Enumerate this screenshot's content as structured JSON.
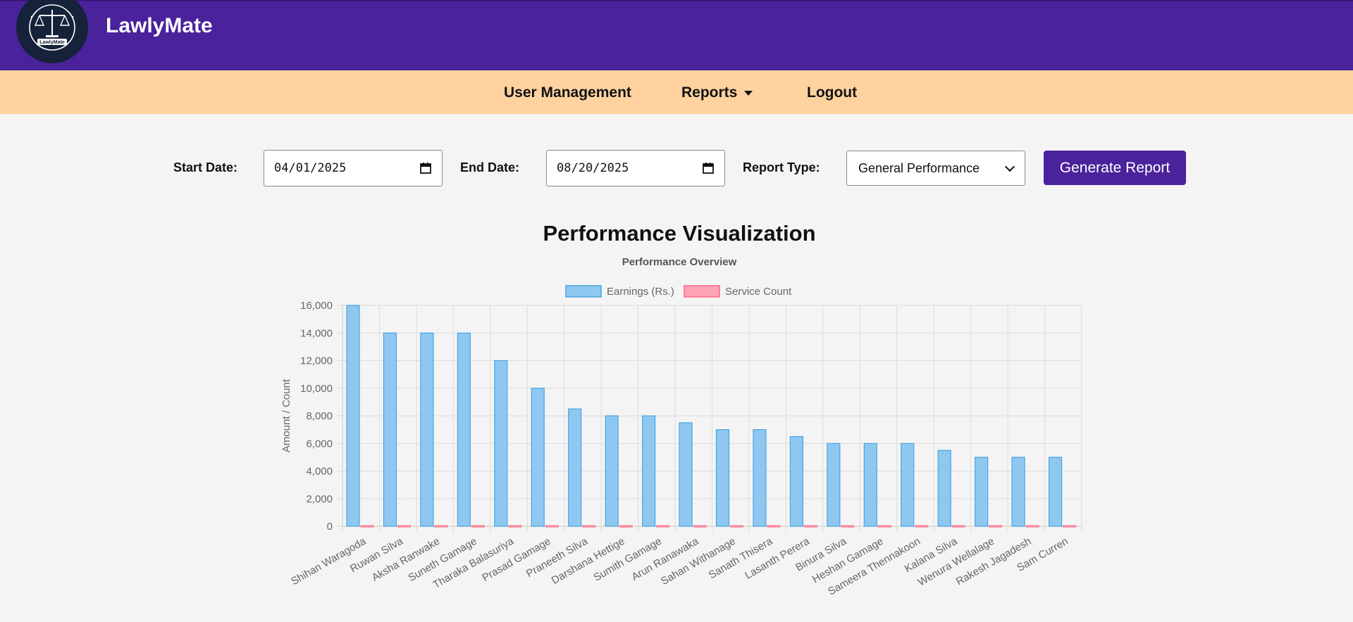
{
  "app": {
    "title": "LawlyMate",
    "logo_text": "LawlyMate"
  },
  "nav": {
    "items": [
      {
        "label": "User Management"
      },
      {
        "label": "Reports"
      },
      {
        "label": "Logout"
      }
    ]
  },
  "form": {
    "start_label": "Start Date:",
    "start_value": "04/01/2025",
    "end_label": "End Date:",
    "end_value": "08/20/2025",
    "type_label": "Report Type:",
    "type_value": "General Performance",
    "button_label": "Generate Report"
  },
  "viz": {
    "title": "Performance Visualization"
  },
  "colors": {
    "header": "#4a229b",
    "navbar": "#ffd29f",
    "earnings_fill": "#8ec8f0",
    "earnings_stroke": "#4aa3e0",
    "service_fill": "#ffa3b5",
    "service_stroke": "#ff6a86"
  },
  "icons": {
    "calendar": "calendar-icon",
    "dropdown": "chevron-down-icon",
    "caret": "caret-down-icon"
  },
  "chart_data": {
    "type": "bar",
    "title": "Performance Overview",
    "ylabel": "Amount / Count",
    "xlabel": "",
    "ylim": [
      0,
      16000
    ],
    "yticks": [
      0,
      2000,
      4000,
      6000,
      8000,
      10000,
      12000,
      14000,
      16000
    ],
    "ytick_labels": [
      "0",
      "2,000",
      "4,000",
      "6,000",
      "8,000",
      "10,000",
      "12,000",
      "14,000",
      "16,000"
    ],
    "grid": true,
    "legend": "top-center",
    "categories": [
      "Shihan Waragoda",
      "Ruwan Silva",
      "Aksha Ranwake",
      "Suneth Gamage",
      "Tharaka Balasuriya",
      "Prasad Gamage",
      "Praneeth Silva",
      "Darshana Hettige",
      "Sumith Gamage",
      "Arun Ranawaka",
      "Sahan Withanage",
      "Sanath Thisera",
      "Lasanth Perera",
      "Binura Silva",
      "Heshan Gamage",
      "Sameera Thennakoon",
      "Kalana Silva",
      "Wenura Wellalage",
      "Rakesh Jagadesh",
      "Sam Curren"
    ],
    "series": [
      {
        "name": "Earnings (Rs.)",
        "values": [
          16000,
          14000,
          14000,
          14000,
          12000,
          10000,
          8500,
          8000,
          8000,
          7500,
          7000,
          7000,
          6500,
          6000,
          6000,
          6000,
          5500,
          5000,
          5000,
          5000
        ]
      },
      {
        "name": "Service Count",
        "values": [
          1,
          1,
          1,
          1,
          1,
          1,
          1,
          1,
          1,
          1,
          1,
          1,
          1,
          1,
          1,
          1,
          1,
          1,
          1,
          1
        ]
      }
    ]
  }
}
